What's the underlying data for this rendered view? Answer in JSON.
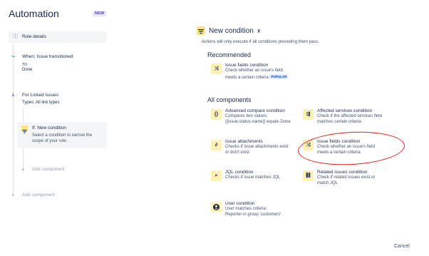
{
  "app": {
    "title": "Automation",
    "badge": "NEW"
  },
  "rule": {
    "details_label": "Rule details",
    "trigger": {
      "title": "When: Issue transitioned",
      "to_label": "TO",
      "to_value": "Done"
    },
    "branch": {
      "title": "For Linked issues",
      "types": "Types: All link types"
    },
    "condition": {
      "title": "If: New condition",
      "description_1": "Select a condition to narrow the",
      "description_2": "scope of your rule."
    },
    "add_component_inner": "Add component",
    "add_component_outer": "Add component"
  },
  "panel": {
    "title": "New condition",
    "description": "Actions will only execute if all conditions preceding them pass.",
    "recommended_heading": "Recommended",
    "recommended": [
      {
        "icon": "shuffle-icon",
        "title": "Issue fields condition",
        "desc_1": "Check whether an issue's field",
        "desc_2": "meets a certain criteria",
        "badge": "POPULAR"
      }
    ],
    "all_heading": "All components",
    "components": [
      {
        "icon": "braces-icon",
        "glyph": "{ }",
        "title": "Advanced compare condition",
        "desc": [
          "Compares two values:",
          "{{issue.status.name}} equals Done"
        ]
      },
      {
        "icon": "affected-services-icon",
        "glyph": "⇶",
        "title": "Affected services condition",
        "desc": [
          "Check if the affected services field",
          "matches certain criteria"
        ]
      },
      {
        "icon": "paperclip-icon",
        "glyph": "⊘",
        "title": "Issue attachments",
        "desc": [
          "Checks if issue attachments exist",
          "or don't exist"
        ]
      },
      {
        "icon": "shuffle-icon",
        "glyph": "⤨",
        "title": "Issue fields condition",
        "desc": [
          "Check whether an issue's field",
          "meets a certain criteria"
        ]
      },
      {
        "icon": "search-icon",
        "glyph": "⌕",
        "title": "JQL condition",
        "desc": [
          "Checks if issue matches JQL"
        ]
      },
      {
        "icon": "link-icon",
        "glyph": "⛓",
        "title": "Related issues condition",
        "desc": [
          "Check if related issues exist or",
          "match JQL"
        ]
      },
      {
        "icon": "user-icon",
        "glyph": "●",
        "title": "User condition",
        "desc": [
          "User matches criteria:",
          "Reporter in group 'customers'"
        ]
      }
    ],
    "cancel_label": "Cancel"
  },
  "colors": {
    "accent": "#ffe380",
    "highlight_circle": "#e01e1e",
    "trigger": "#36b37e",
    "branch": "#6554c0"
  }
}
